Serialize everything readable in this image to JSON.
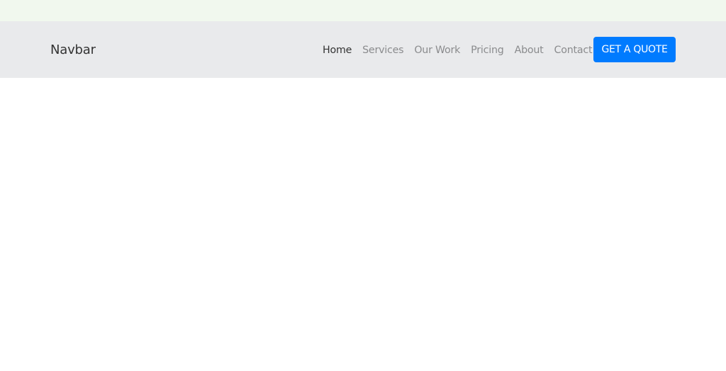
{
  "navbar": {
    "brand": "Navbar",
    "links": [
      {
        "label": "Home",
        "active": true
      },
      {
        "label": "Services",
        "active": false
      },
      {
        "label": "Our Work",
        "active": false
      },
      {
        "label": "Pricing",
        "active": false
      },
      {
        "label": "About",
        "active": false
      },
      {
        "label": "Contact",
        "active": false
      }
    ],
    "cta_label": "GET A QUOTE"
  },
  "colors": {
    "top_band": "#f1f8ee",
    "navbar_bg": "#e9eaec",
    "accent": "#007bff",
    "link_active": "#333333",
    "link_muted": "#8a8b8d"
  }
}
